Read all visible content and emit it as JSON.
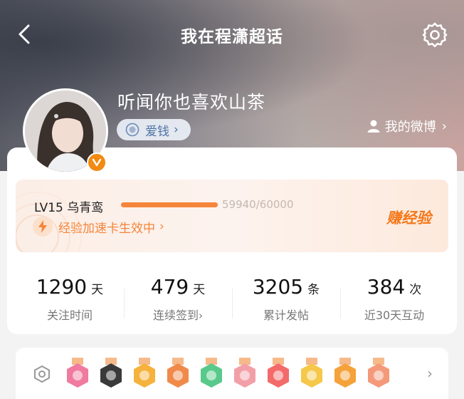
{
  "header": {
    "title": "我在程潇超话"
  },
  "profile": {
    "username": "听闻你也喜欢山茶",
    "tag": "爱钱",
    "weibo_link": "我的微博"
  },
  "level": {
    "label": "LV15 乌青鸾",
    "progress_text": "59940/60000",
    "progress_fraction": 0.999,
    "boost_text": "经验加速卡生效中",
    "earn_label": "赚经验"
  },
  "stats": [
    {
      "value": "1290",
      "unit": "天",
      "label": "关注时间",
      "link": false
    },
    {
      "value": "479",
      "unit": "天",
      "label": "连续签到",
      "link": true
    },
    {
      "value": "3205",
      "unit": "条",
      "label": "累计发帖",
      "link": false
    },
    {
      "value": "384",
      "unit": "次",
      "label": "近30天互动",
      "link": false
    }
  ],
  "badges": {
    "icon": "badge-shield-icon",
    "items": [
      "lv15-badge",
      "lion-badge",
      "crown-badge",
      "pet-badge",
      "hands-badge",
      "100days-badge",
      "heart-badge",
      "30days-badge",
      "trophy-badge",
      "gift-badge"
    ]
  },
  "colors": {
    "accent": "#f5853a",
    "tag_text": "#4d74a6",
    "avatar_badge": "#f28a13"
  }
}
